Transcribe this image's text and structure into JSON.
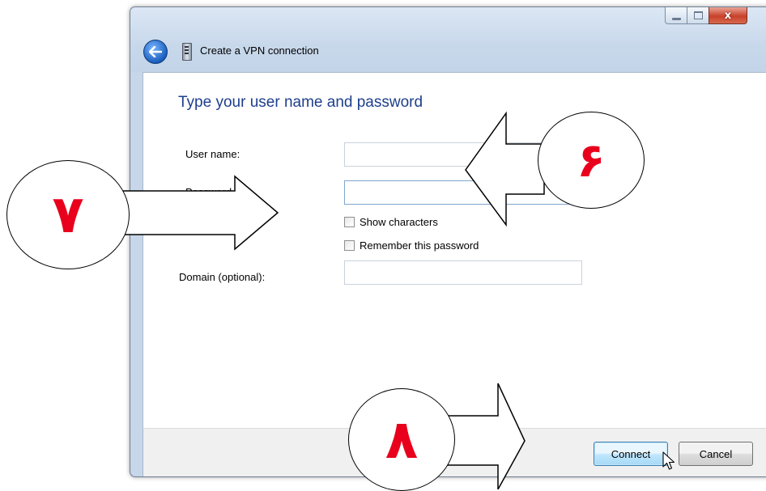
{
  "window": {
    "title": "Create a VPN connection",
    "buttons": {
      "minimize": "minimize",
      "maximize": "maximize",
      "close": "x"
    }
  },
  "form": {
    "heading": "Type your user name and password",
    "username_label": "User name:",
    "username_value": "",
    "password_label": "Password",
    "password_value": "",
    "show_characters_label": "Show characters",
    "show_characters_checked": false,
    "remember_label": "Remember this password",
    "remember_checked": false,
    "domain_label": "Domain (optional):",
    "domain_value": ""
  },
  "footer": {
    "connect_label": "Connect",
    "cancel_label": "Cancel"
  },
  "annotations": {
    "six": "۶",
    "seven": "۷",
    "eight": "۸",
    "number_color": "#e8001c"
  },
  "icons": {
    "back": "back-arrow-icon",
    "vpn": "network-device-icon",
    "cursor": "mouse-pointer-icon"
  }
}
